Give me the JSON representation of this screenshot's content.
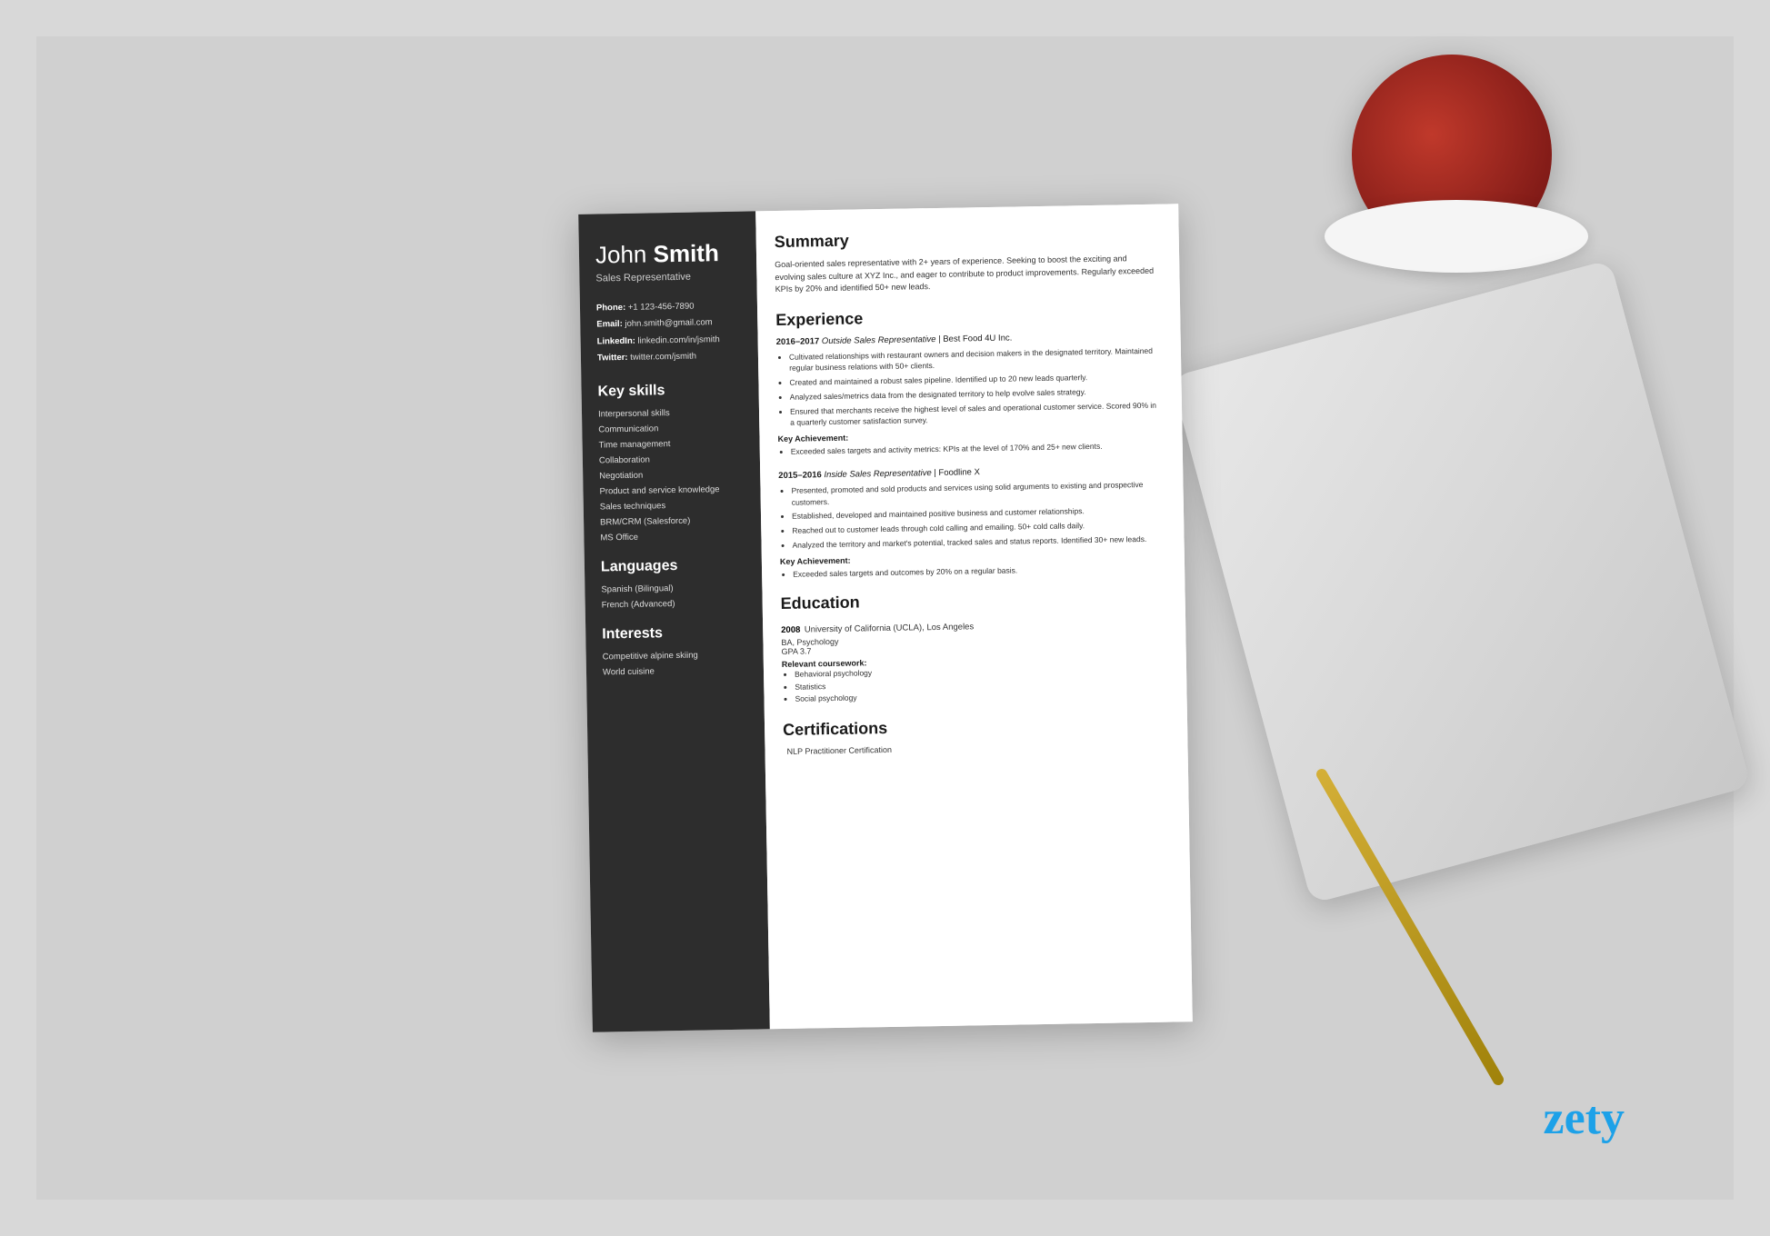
{
  "page": {
    "background_color": "#d0d0d0",
    "zety_logo": "zety"
  },
  "resume": {
    "sidebar": {
      "name_first": "John ",
      "name_last": "Smith",
      "title": "Sales Representative",
      "contact": [
        {
          "label": "Phone:",
          "value": "+1 123-456-7890"
        },
        {
          "label": "Email:",
          "value": "john.smith@gmail.com"
        },
        {
          "label": "LinkedIn:",
          "value": "linkedin.com/in/jsmith"
        },
        {
          "label": "Twitter:",
          "value": "twitter.com/jsmith"
        }
      ],
      "skills_heading": "Key skills",
      "skills": [
        "Interpersonal skills",
        "Communication",
        "Time management",
        "Collaboration",
        "Negotiation",
        "Product and service knowledge",
        "Sales techniques",
        "BRM/CRM (Salesforce)",
        "MS Office"
      ],
      "languages_heading": "Languages",
      "languages": [
        "Spanish (Bilingual)",
        "French (Advanced)"
      ],
      "interests_heading": "Interests",
      "interests": [
        "Competitive alpine skiing",
        "World cuisine"
      ]
    },
    "main": {
      "summary_heading": "Summary",
      "summary_text": "Goal-oriented sales representative with 2+ years of experience. Seeking to boost the exciting and evolving sales culture at XYZ Inc., and eager to contribute to product improvements. Regularly exceeded KPIs by 20% and identified 50+ new leads.",
      "experience_heading": "Experience",
      "experience": [
        {
          "years": "2016–2017",
          "role": "Outside Sales Representative",
          "company": "Best Food 4U Inc.",
          "bullets": [
            "Cultivated relationships with restaurant owners and decision makers in the designated territory. Maintained regular business relations with 50+ clients.",
            "Created and maintained a robust sales pipeline. Identified up to 20 new leads quarterly.",
            "Analyzed sales/metrics data from the designated territory to help evolve sales strategy.",
            "Ensured that merchants receive the highest level of sales and operational customer service. Scored 90% in a quarterly customer satisfaction survey."
          ],
          "achievement_label": "Key Achievement:",
          "achievement": "Exceeded sales targets and activity metrics: KPIs at the level of 170% and 25+ new clients."
        },
        {
          "years": "2015–2016",
          "role": "Inside Sales Representative",
          "company": "Foodline X",
          "bullets": [
            "Presented, promoted and sold products and services using solid arguments to existing and prospective customers.",
            "Established, developed and maintained positive business and customer relationships.",
            "Reached out to customer leads through cold calling and emailing. 50+ cold calls daily.",
            "Analyzed the territory and market's potential, tracked sales and status reports. Identified 30+ new leads."
          ],
          "achievement_label": "Key Achievement:",
          "achievement": "Exceeded sales targets and outcomes by 20% on a regular basis."
        }
      ],
      "education_heading": "Education",
      "education": [
        {
          "year": "2008",
          "school": "University of California (UCLA), Los Angeles",
          "degree": "BA, Psychology",
          "gpa": "GPA 3.7",
          "coursework_label": "Relevant coursework:",
          "coursework": [
            "Behavioral psychology",
            "Statistics",
            "Social psychology"
          ]
        }
      ],
      "certifications_heading": "Certifications",
      "certifications": [
        "NLP Practitioner Certification"
      ]
    }
  }
}
